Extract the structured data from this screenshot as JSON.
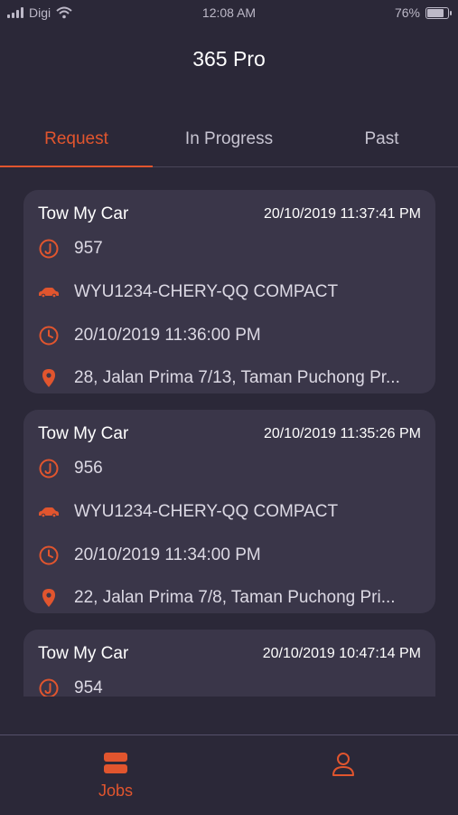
{
  "status_bar": {
    "carrier": "Digi",
    "time": "12:08 AM",
    "battery": "76%",
    "battery_level": 0.76
  },
  "app_title": "365 Pro",
  "tabs": [
    {
      "label": "Request",
      "active": true
    },
    {
      "label": "In Progress",
      "active": false
    },
    {
      "label": "Past",
      "active": false
    }
  ],
  "jobs": [
    {
      "service": "Tow My Car",
      "created": "20/10/2019 11:37:41 PM",
      "job_no": "957",
      "vehicle": "WYU1234-CHERY-QQ COMPACT",
      "scheduled": "20/10/2019 11:36:00 PM",
      "address": "28, Jalan Prima 7/13, Taman Puchong Pr..."
    },
    {
      "service": "Tow My Car",
      "created": "20/10/2019 11:35:26 PM",
      "job_no": "956",
      "vehicle": "WYU1234-CHERY-QQ COMPACT",
      "scheduled": "20/10/2019 11:34:00 PM",
      "address": "22, Jalan Prima 7/8, Taman Puchong Pri..."
    },
    {
      "service": "Tow My Car",
      "created": "20/10/2019 10:47:14 PM",
      "job_no": "954"
    }
  ],
  "bottom_nav": {
    "jobs_label": "Jobs"
  },
  "colors": {
    "accent": "#e1552e",
    "background": "#2b2838",
    "card": "#3a3649"
  },
  "icons": {
    "job_number": "j-circle-icon",
    "vehicle": "car-icon",
    "time": "clock-icon",
    "address": "location-pin-icon",
    "jobs_tab": "stack-icon",
    "profile_tab": "person-icon"
  }
}
